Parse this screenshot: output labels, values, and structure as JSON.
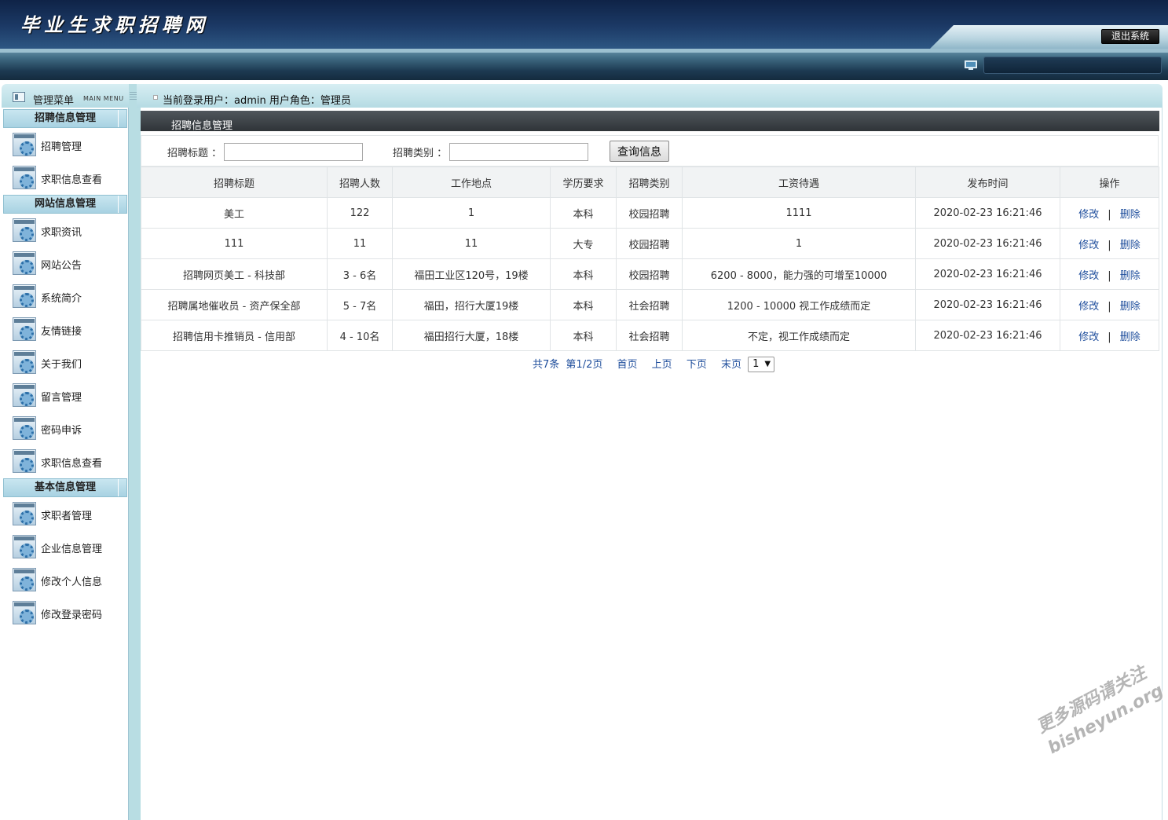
{
  "header": {
    "site_title": "毕业生求职招聘网",
    "logout_label": "退出系统"
  },
  "sidebar": {
    "title": "管理菜单",
    "title_en": "MAIN MENU",
    "groups": [
      {
        "label": "招聘信息管理",
        "items": [
          {
            "label": "招聘管理"
          },
          {
            "label": "求职信息查看"
          }
        ]
      },
      {
        "label": "网站信息管理",
        "items": [
          {
            "label": "求职资讯"
          },
          {
            "label": "网站公告"
          },
          {
            "label": "系统简介"
          },
          {
            "label": "友情链接"
          },
          {
            "label": "关于我们"
          },
          {
            "label": "留言管理"
          },
          {
            "label": "密码申诉"
          },
          {
            "label": "求职信息查看"
          }
        ]
      },
      {
        "label": "基本信息管理",
        "items": [
          {
            "label": "求职者管理"
          },
          {
            "label": "企业信息管理"
          },
          {
            "label": "修改个人信息"
          },
          {
            "label": "修改登录密码"
          }
        ]
      }
    ]
  },
  "topbar": {
    "user_info": "当前登录用户：admin  用户角色：管理员"
  },
  "main": {
    "section_title": "招聘信息管理",
    "search": {
      "title_label": "招聘标题 ：",
      "title_value": "",
      "category_label": "招聘类别 ：",
      "category_value": "",
      "button_label": "查询信息"
    },
    "table": {
      "columns": [
        "招聘标题",
        "招聘人数",
        "工作地点",
        "学历要求",
        "招聘类别",
        "工资待遇",
        "发布时间",
        "操作"
      ],
      "rows": [
        {
          "title": "美工",
          "count": "122",
          "location": "1",
          "education": "本科",
          "category": "校园招聘",
          "salary": "1111",
          "time": "2020-02-23 16:21:46"
        },
        {
          "title": "111",
          "count": "11",
          "location": "11",
          "education": "大专",
          "category": "校园招聘",
          "salary": "1",
          "time": "2020-02-23 16:21:46"
        },
        {
          "title": "招聘网页美工 - 科技部",
          "count": "3 - 6名",
          "location": "福田工业区120号，19楼",
          "education": "本科",
          "category": "校园招聘",
          "salary": "6200 - 8000，能力强的可增至10000",
          "time": "2020-02-23 16:21:46"
        },
        {
          "title": "招聘属地催收员 - 资产保全部",
          "count": "5 - 7名",
          "location": "福田，招行大厦19楼",
          "education": "本科",
          "category": "社会招聘",
          "salary": "1200 - 10000 视工作成绩而定",
          "time": "2020-02-23 16:21:46"
        },
        {
          "title": "招聘信用卡推销员 - 信用部",
          "count": "4 - 10名",
          "location": "福田招行大厦，18楼",
          "education": "本科",
          "category": "社会招聘",
          "salary": "不定，视工作成绩而定",
          "time": "2020-02-23 16:21:46"
        }
      ],
      "edit_label": "修改",
      "separator": "|",
      "delete_label": "删除"
    },
    "pagination": {
      "total": "共7条",
      "page_info": "第1/2页",
      "first": "首页",
      "prev": "上页",
      "next": "下页",
      "last": "末页",
      "selected_page": "1"
    }
  },
  "watermark": {
    "line1": "更多源码请关注",
    "line2": "bisheyun.org"
  },
  "icons": {
    "menu": "menu-icon",
    "nav_item": "gear-icon",
    "monitor": "monitor-icon"
  }
}
